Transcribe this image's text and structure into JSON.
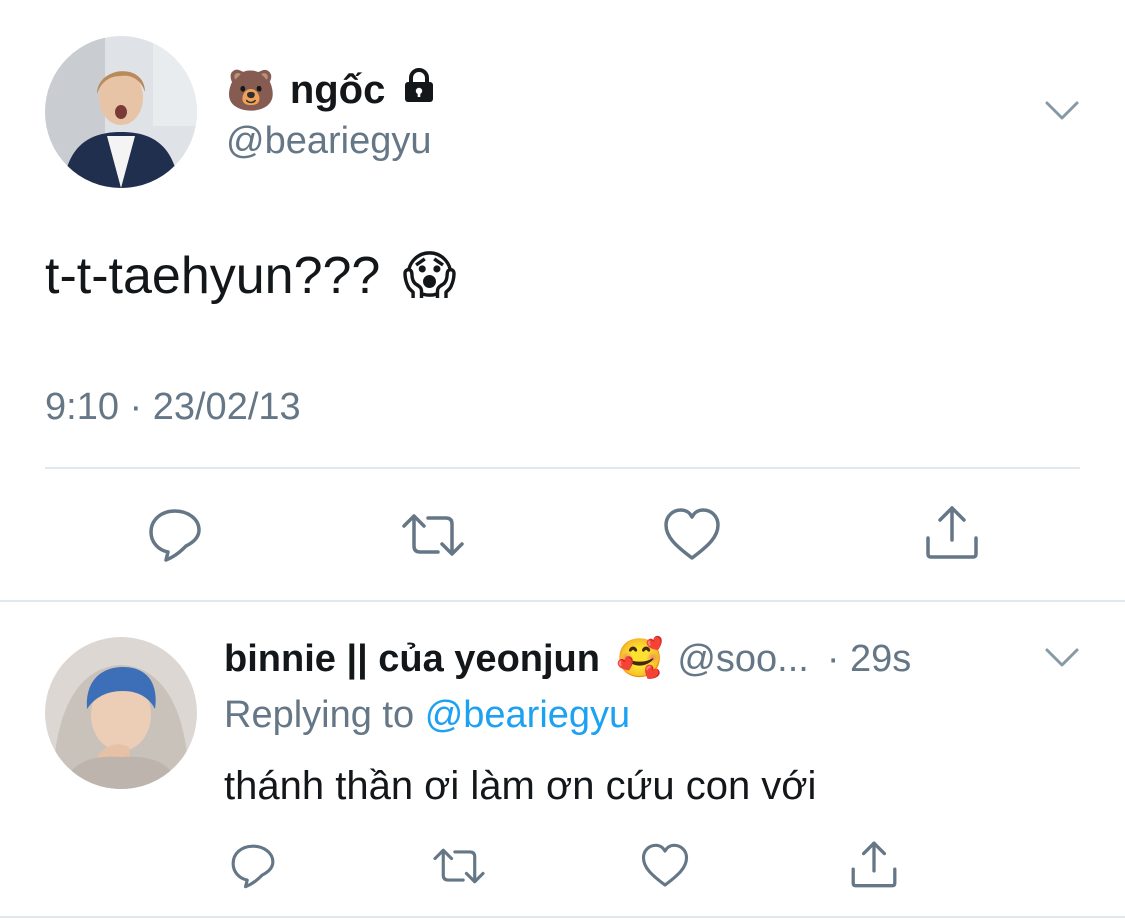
{
  "colors": {
    "text": "#14171a",
    "secondary": "#657786",
    "link": "#1da1f2",
    "divider": "#e1e8ed",
    "icon": "#657786"
  },
  "main_tweet": {
    "name_emoji": "🐻",
    "display_name": "ngốc",
    "locked_icon": "lock-icon",
    "handle": "@beariegyu",
    "text": "t-t-taehyun???",
    "text_emoji": "😱",
    "timestamp": "9:10 · 23/02/13",
    "actions": [
      "reply-icon",
      "retweet-icon",
      "like-icon",
      "share-icon"
    ]
  },
  "reply_tweet": {
    "display_name": "binnie || của yeonjun",
    "name_emoji": "🥰",
    "handle": "@soo...",
    "time": "· 29s",
    "replying_prefix": "Replying to",
    "replying_mention": "@beariegyu",
    "text": "thánh thần ơi làm ơn cứu con với",
    "actions": [
      "reply-icon",
      "retweet-icon",
      "like-icon",
      "share-icon"
    ]
  }
}
